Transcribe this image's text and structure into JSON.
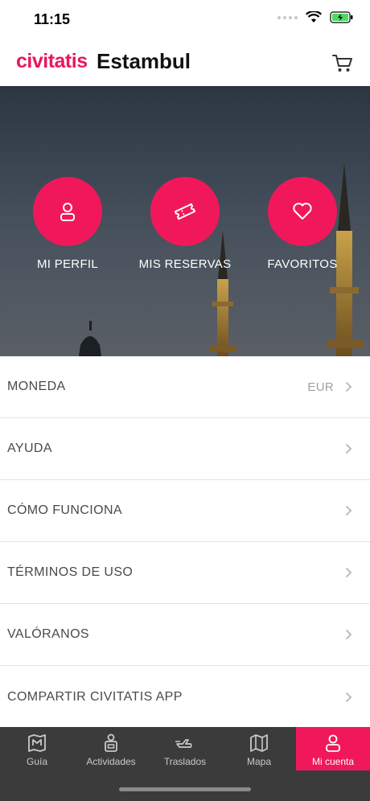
{
  "status_bar": {
    "time": "11:15"
  },
  "header": {
    "logo": "civitatis",
    "city": "Estambul",
    "cart_icon": "cart-icon"
  },
  "hero": {
    "actions": [
      {
        "label": "MI PERFIL",
        "icon": "user-icon"
      },
      {
        "label": "MIS RESERVAS",
        "icon": "ticket-icon"
      },
      {
        "label": "FAVORITOS",
        "icon": "heart-icon"
      }
    ]
  },
  "menu": {
    "items": [
      {
        "label": "MONEDA",
        "value": "EUR"
      },
      {
        "label": "AYUDA",
        "value": ""
      },
      {
        "label": "CÓMO FUNCIONA",
        "value": ""
      },
      {
        "label": "TÉRMINOS DE USO",
        "value": ""
      },
      {
        "label": "VALÓRANOS",
        "value": ""
      },
      {
        "label": "COMPARTIR CIVITATIS APP",
        "value": ""
      }
    ]
  },
  "tabbar": {
    "tabs": [
      {
        "label": "Guía",
        "icon": "map-book-icon"
      },
      {
        "label": "Actividades",
        "icon": "activities-icon"
      },
      {
        "label": "Traslados",
        "icon": "transfer-icon"
      },
      {
        "label": "Mapa",
        "icon": "map-icon"
      },
      {
        "label": "Mi cuenta",
        "icon": "account-icon",
        "active": true
      }
    ]
  },
  "colors": {
    "brand": "#f0185b",
    "tabbar": "#3b3b3b"
  }
}
